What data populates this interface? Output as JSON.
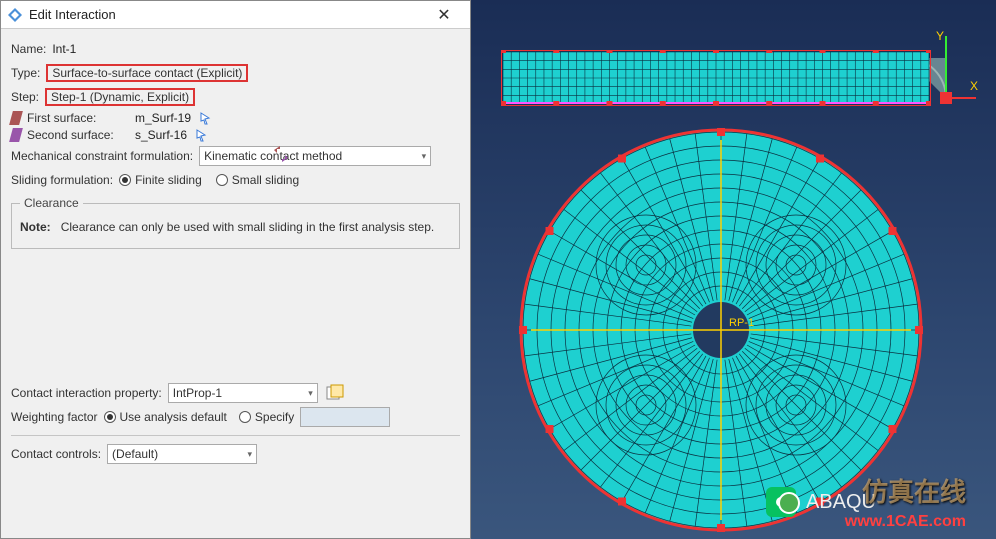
{
  "dialog": {
    "title": "Edit Interaction",
    "name_label": "Name:",
    "name_value": "Int-1",
    "type_label": "Type:",
    "type_value": "Surface-to-surface contact (Explicit)",
    "step_label": "Step:",
    "step_value": "Step-1 (Dynamic, Explicit)",
    "first_surface_label": "First surface:",
    "first_surface_value": "m_Surf-19",
    "second_surface_label": "Second surface:",
    "second_surface_value": "s_Surf-16",
    "mech_formulation_label": "Mechanical constraint formulation:",
    "mech_formulation_value": "Kinematic contact method",
    "sliding_label": "Sliding formulation:",
    "sliding_finite": "Finite sliding",
    "sliding_small": "Small sliding",
    "clearance_legend": "Clearance",
    "clearance_note_label": "Note:",
    "clearance_note_text": "Clearance can only be used with small sliding in the first analysis step.",
    "contact_prop_label": "Contact interaction property:",
    "contact_prop_value": "IntProp-1",
    "weighting_label": "Weighting factor",
    "weighting_default": "Use analysis default",
    "weighting_specify": "Specify",
    "contact_controls_label": "Contact controls:",
    "contact_controls_value": "(Default)"
  },
  "viewport": {
    "axis_x": "X",
    "axis_y": "Y",
    "rp_label": "RP-1",
    "watermark": "1CAE.COM",
    "wm_cn": "仿真在线",
    "wm_url": "www.1CAE.com",
    "wm_abq": "ABAQU"
  }
}
